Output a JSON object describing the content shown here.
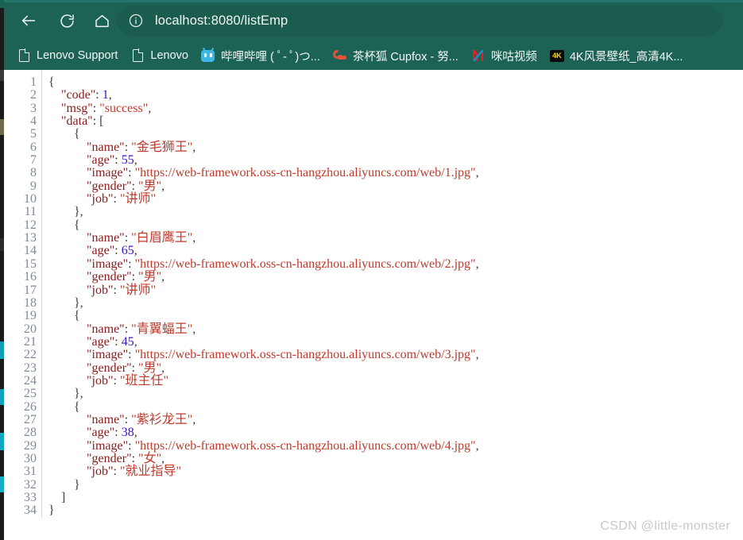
{
  "browser": {
    "chrome_color": "#1d6355",
    "addressbar_color": "#1a5c4e",
    "url": "localhost:8080/listEmp",
    "nav": {
      "back_label": "Back",
      "reload_label": "Refresh",
      "home_label": "Home",
      "site_info_label": "View site information"
    },
    "bookmarks": [
      {
        "label": "Lenovo Support",
        "icon": "page-icon"
      },
      {
        "label": "Lenovo",
        "icon": "page-icon"
      },
      {
        "label": "哔哩哔哩 ( ﾟ- ﾟ)つ...",
        "icon": "bilibili-icon"
      },
      {
        "label": "茶杯狐 Cupfox - 努...",
        "icon": "cupfox-icon"
      },
      {
        "label": "咪咕视频",
        "icon": "migu-icon"
      },
      {
        "label": "4K风景壁纸_高清4K...",
        "icon": "fourk-icon"
      }
    ]
  },
  "watermark": "CSDN @little-monster",
  "json_response": {
    "code": 1,
    "msg": "success",
    "data": [
      {
        "name": "金毛狮王",
        "age": 55,
        "image": "https://web-framework.oss-cn-hangzhou.aliyuncs.com/web/1.jpg",
        "gender": "男",
        "job": "讲师"
      },
      {
        "name": "白眉鹰王",
        "age": 65,
        "image": "https://web-framework.oss-cn-hangzhou.aliyuncs.com/web/2.jpg",
        "gender": "男",
        "job": "讲师"
      },
      {
        "name": "青翼蝠王",
        "age": 45,
        "image": "https://web-framework.oss-cn-hangzhou.aliyuncs.com/web/3.jpg",
        "gender": "男",
        "job": "班主任"
      },
      {
        "name": "紫衫龙王",
        "age": 38,
        "image": "https://web-framework.oss-cn-hangzhou.aliyuncs.com/web/4.jpg",
        "gender": "女",
        "job": "就业指导"
      }
    ]
  },
  "code_view": {
    "total_lines": 34,
    "lines": [
      [
        {
          "t": "{",
          "c": "p"
        }
      ],
      [
        {
          "t": "    ",
          "c": "p"
        },
        {
          "t": "\"code\"",
          "c": "k"
        },
        {
          "t": ": ",
          "c": "p"
        },
        {
          "t": "1",
          "c": "n"
        },
        {
          "t": ",",
          "c": "p"
        }
      ],
      [
        {
          "t": "    ",
          "c": "p"
        },
        {
          "t": "\"msg\"",
          "c": "k"
        },
        {
          "t": ": ",
          "c": "p"
        },
        {
          "t": "\"success\"",
          "c": "s"
        },
        {
          "t": ",",
          "c": "p"
        }
      ],
      [
        {
          "t": "    ",
          "c": "p"
        },
        {
          "t": "\"data\"",
          "c": "k"
        },
        {
          "t": ": [",
          "c": "p"
        }
      ],
      [
        {
          "t": "        {",
          "c": "p"
        }
      ],
      [
        {
          "t": "            ",
          "c": "p"
        },
        {
          "t": "\"name\"",
          "c": "k"
        },
        {
          "t": ": ",
          "c": "p"
        },
        {
          "t": "\"金毛狮王\"",
          "c": "s"
        },
        {
          "t": ",",
          "c": "p"
        }
      ],
      [
        {
          "t": "            ",
          "c": "p"
        },
        {
          "t": "\"age\"",
          "c": "k"
        },
        {
          "t": ": ",
          "c": "p"
        },
        {
          "t": "55",
          "c": "n"
        },
        {
          "t": ",",
          "c": "p"
        }
      ],
      [
        {
          "t": "            ",
          "c": "p"
        },
        {
          "t": "\"image\"",
          "c": "k"
        },
        {
          "t": ": ",
          "c": "p"
        },
        {
          "t": "\"https://web-framework.oss-cn-hangzhou.aliyuncs.com/web/1.jpg\"",
          "c": "s"
        },
        {
          "t": ",",
          "c": "p"
        }
      ],
      [
        {
          "t": "            ",
          "c": "p"
        },
        {
          "t": "\"gender\"",
          "c": "k"
        },
        {
          "t": ": ",
          "c": "p"
        },
        {
          "t": "\"男\"",
          "c": "s"
        },
        {
          "t": ",",
          "c": "p"
        }
      ],
      [
        {
          "t": "            ",
          "c": "p"
        },
        {
          "t": "\"job\"",
          "c": "k"
        },
        {
          "t": ": ",
          "c": "p"
        },
        {
          "t": "\"讲师\"",
          "c": "s"
        }
      ],
      [
        {
          "t": "        },",
          "c": "p"
        }
      ],
      [
        {
          "t": "        {",
          "c": "p"
        }
      ],
      [
        {
          "t": "            ",
          "c": "p"
        },
        {
          "t": "\"name\"",
          "c": "k"
        },
        {
          "t": ": ",
          "c": "p"
        },
        {
          "t": "\"白眉鹰王\"",
          "c": "s"
        },
        {
          "t": ",",
          "c": "p"
        }
      ],
      [
        {
          "t": "            ",
          "c": "p"
        },
        {
          "t": "\"age\"",
          "c": "k"
        },
        {
          "t": ": ",
          "c": "p"
        },
        {
          "t": "65",
          "c": "n"
        },
        {
          "t": ",",
          "c": "p"
        }
      ],
      [
        {
          "t": "            ",
          "c": "p"
        },
        {
          "t": "\"image\"",
          "c": "k"
        },
        {
          "t": ": ",
          "c": "p"
        },
        {
          "t": "\"https://web-framework.oss-cn-hangzhou.aliyuncs.com/web/2.jpg\"",
          "c": "s"
        },
        {
          "t": ",",
          "c": "p"
        }
      ],
      [
        {
          "t": "            ",
          "c": "p"
        },
        {
          "t": "\"gender\"",
          "c": "k"
        },
        {
          "t": ": ",
          "c": "p"
        },
        {
          "t": "\"男\"",
          "c": "s"
        },
        {
          "t": ",",
          "c": "p"
        }
      ],
      [
        {
          "t": "            ",
          "c": "p"
        },
        {
          "t": "\"job\"",
          "c": "k"
        },
        {
          "t": ": ",
          "c": "p"
        },
        {
          "t": "\"讲师\"",
          "c": "s"
        }
      ],
      [
        {
          "t": "        },",
          "c": "p"
        }
      ],
      [
        {
          "t": "        {",
          "c": "p"
        }
      ],
      [
        {
          "t": "            ",
          "c": "p"
        },
        {
          "t": "\"name\"",
          "c": "k"
        },
        {
          "t": ": ",
          "c": "p"
        },
        {
          "t": "\"青翼蝠王\"",
          "c": "s"
        },
        {
          "t": ",",
          "c": "p"
        }
      ],
      [
        {
          "t": "            ",
          "c": "p"
        },
        {
          "t": "\"age\"",
          "c": "k"
        },
        {
          "t": ": ",
          "c": "p"
        },
        {
          "t": "45",
          "c": "n"
        },
        {
          "t": ",",
          "c": "p"
        }
      ],
      [
        {
          "t": "            ",
          "c": "p"
        },
        {
          "t": "\"image\"",
          "c": "k"
        },
        {
          "t": ": ",
          "c": "p"
        },
        {
          "t": "\"https://web-framework.oss-cn-hangzhou.aliyuncs.com/web/3.jpg\"",
          "c": "s"
        },
        {
          "t": ",",
          "c": "p"
        }
      ],
      [
        {
          "t": "            ",
          "c": "p"
        },
        {
          "t": "\"gender\"",
          "c": "k"
        },
        {
          "t": ": ",
          "c": "p"
        },
        {
          "t": "\"男\"",
          "c": "s"
        },
        {
          "t": ",",
          "c": "p"
        }
      ],
      [
        {
          "t": "            ",
          "c": "p"
        },
        {
          "t": "\"job\"",
          "c": "k"
        },
        {
          "t": ": ",
          "c": "p"
        },
        {
          "t": "\"班主任\"",
          "c": "s"
        }
      ],
      [
        {
          "t": "        },",
          "c": "p"
        }
      ],
      [
        {
          "t": "        {",
          "c": "p"
        }
      ],
      [
        {
          "t": "            ",
          "c": "p"
        },
        {
          "t": "\"name\"",
          "c": "k"
        },
        {
          "t": ": ",
          "c": "p"
        },
        {
          "t": "\"紫衫龙王\"",
          "c": "s"
        },
        {
          "t": ",",
          "c": "p"
        }
      ],
      [
        {
          "t": "            ",
          "c": "p"
        },
        {
          "t": "\"age\"",
          "c": "k"
        },
        {
          "t": ": ",
          "c": "p"
        },
        {
          "t": "38",
          "c": "n"
        },
        {
          "t": ",",
          "c": "p"
        }
      ],
      [
        {
          "t": "            ",
          "c": "p"
        },
        {
          "t": "\"image\"",
          "c": "k"
        },
        {
          "t": ": ",
          "c": "p"
        },
        {
          "t": "\"https://web-framework.oss-cn-hangzhou.aliyuncs.com/web/4.jpg\"",
          "c": "s"
        },
        {
          "t": ",",
          "c": "p"
        }
      ],
      [
        {
          "t": "            ",
          "c": "p"
        },
        {
          "t": "\"gender\"",
          "c": "k"
        },
        {
          "t": ": ",
          "c": "p"
        },
        {
          "t": "\"女\"",
          "c": "s"
        },
        {
          "t": ",",
          "c": "p"
        }
      ],
      [
        {
          "t": "            ",
          "c": "p"
        },
        {
          "t": "\"job\"",
          "c": "k"
        },
        {
          "t": ": ",
          "c": "p"
        },
        {
          "t": "\"就业指导\"",
          "c": "s"
        }
      ],
      [
        {
          "t": "        }",
          "c": "p"
        }
      ],
      [
        {
          "t": "    ]",
          "c": "p"
        }
      ],
      [
        {
          "t": "}",
          "c": "p"
        }
      ]
    ]
  }
}
